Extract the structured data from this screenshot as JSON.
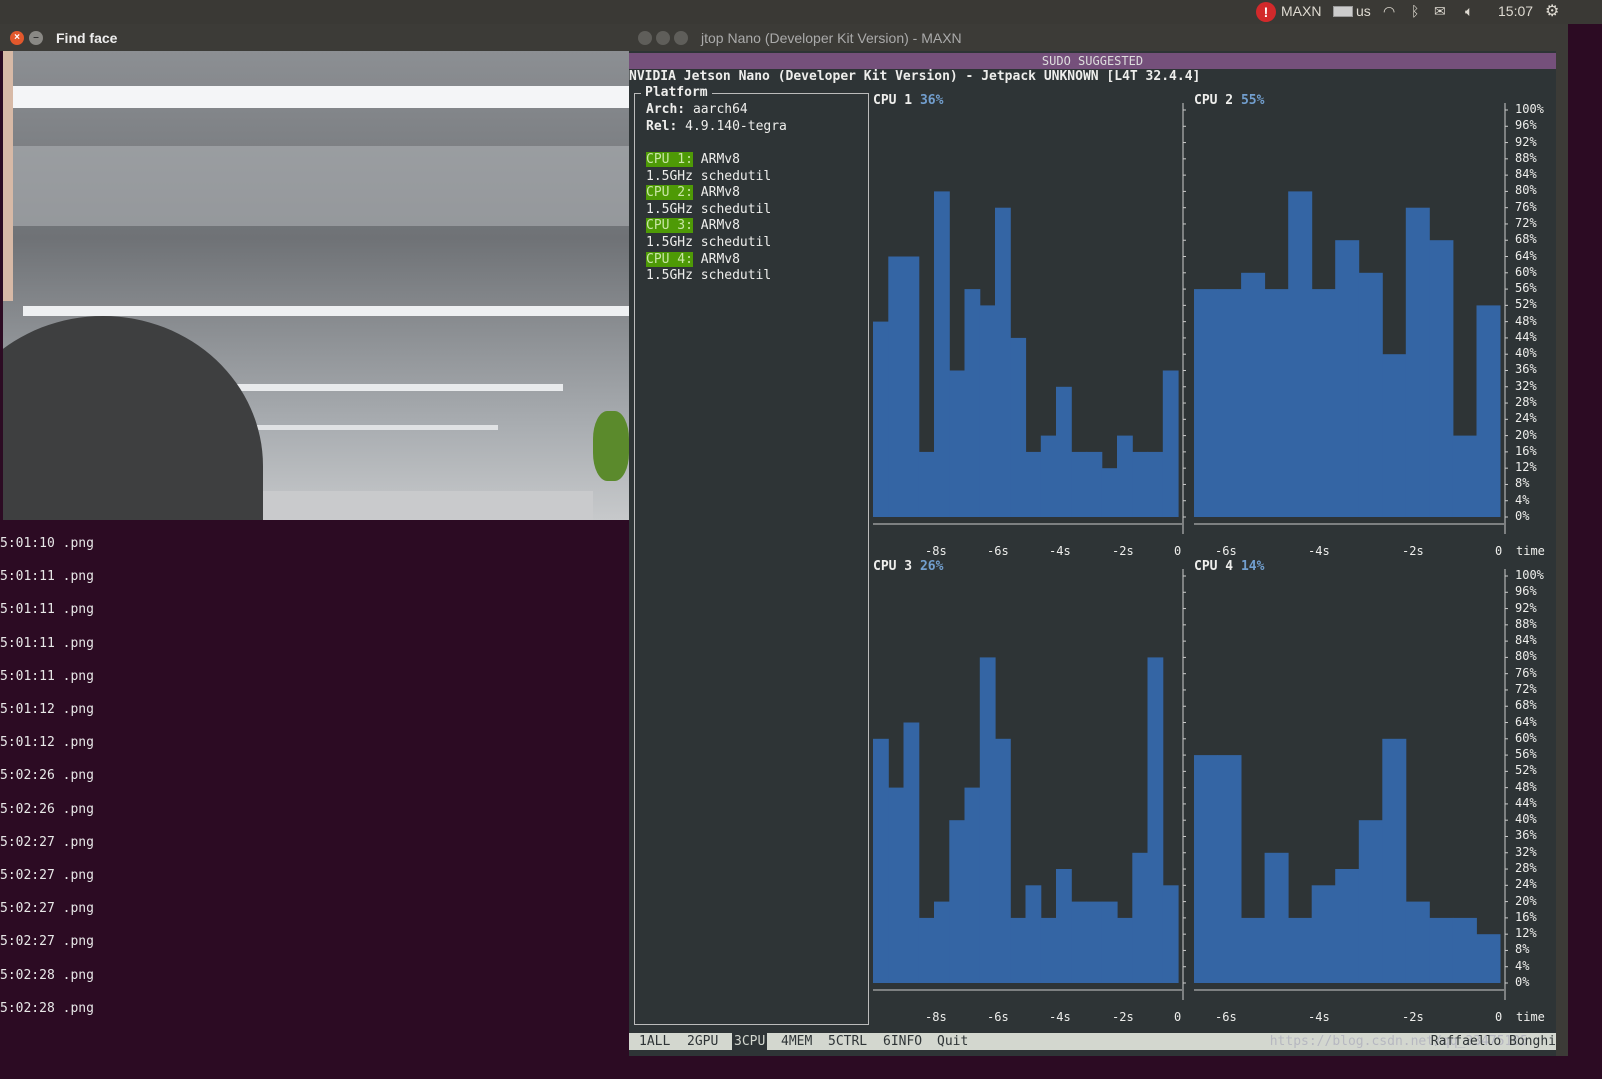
{
  "topbar": {
    "power_mode": "MAXN",
    "keyboard": "us",
    "time": "15:07",
    "icons": [
      "alert-icon",
      "keyboard-icon",
      "wifi-icon",
      "bluetooth-icon",
      "mail-icon",
      "volume-icon",
      "power-gear-icon"
    ]
  },
  "findface": {
    "title": "Find face"
  },
  "terminal": {
    "lines": [
      "5:01:10 .png",
      "5:01:11 .png",
      "5:01:11 .png",
      "5:01:11 .png",
      "5:01:11 .png",
      "5:01:12 .png",
      "5:01:12 .png",
      "5:02:26 .png",
      "5:02:26 .png",
      "5:02:27 .png",
      "5:02:27 .png",
      "5:02:27 .png",
      "5:02:27 .png",
      "5:02:28 .png",
      "5:02:28 .png"
    ]
  },
  "jtop": {
    "title": "jtop Nano (Developer Kit Version) - MAXN",
    "sudo": "SUDO SUGGESTED",
    "header": "NVIDIA Jetson Nano (Developer Kit Version) - Jetpack UNKNOWN [L4T 32.4.4]",
    "platform": {
      "title": "Platform",
      "arch_label": "Arch:",
      "arch": "aarch64",
      "rel_label": "Rel:",
      "rel": "4.9.140-tegra",
      "cpus": [
        {
          "label": "CPU 1:",
          "arch": "ARMv8",
          "freq": "1.5GHz schedutil"
        },
        {
          "label": "CPU 2:",
          "arch": "ARMv8",
          "freq": "1.5GHz schedutil"
        },
        {
          "label": "CPU 3:",
          "arch": "ARMv8",
          "freq": "1.5GHz schedutil"
        },
        {
          "label": "CPU 4:",
          "arch": "ARMv8",
          "freq": "1.5GHz schedutil"
        }
      ]
    },
    "bottom": {
      "tabs": [
        "1ALL",
        "2GPU",
        "3CPU",
        "4MEM",
        "5CTRL",
        "6INFO",
        "Quit"
      ],
      "selected": "3CPU",
      "author": "Raffaello Bonghi",
      "watermark": "https://blog.csdn.net/qq_33475105"
    }
  },
  "chart_data": [
    {
      "type": "bar",
      "title": "CPU 1",
      "value_label": "36%",
      "x_ticks": [
        "-8s",
        "-6s",
        "-4s",
        "-2s",
        "0"
      ],
      "ylim": [
        0,
        100
      ],
      "values": [
        48,
        64,
        64,
        16,
        80,
        36,
        56,
        52,
        76,
        44,
        16,
        20,
        32,
        16,
        16,
        12,
        20,
        16,
        16,
        36
      ],
      "color": "#3465a4"
    },
    {
      "type": "bar",
      "title": "CPU 2",
      "value_label": "55%",
      "x_ticks": [
        "-6s",
        "-4s",
        "-2s",
        "0"
      ],
      "xlabel": "time",
      "ylim": [
        0,
        100
      ],
      "y_ticks": [
        "100%",
        "96%",
        "92%",
        "88%",
        "84%",
        "80%",
        "76%",
        "72%",
        "68%",
        "64%",
        "60%",
        "56%",
        "52%",
        "48%",
        "44%",
        "40%",
        "36%",
        "32%",
        "28%",
        "24%",
        "20%",
        "16%",
        "12%",
        "8%",
        "4%",
        "0%"
      ],
      "values": [
        56,
        56,
        60,
        56,
        80,
        56,
        68,
        60,
        40,
        76,
        68,
        20,
        52
      ],
      "color": "#3465a4"
    },
    {
      "type": "bar",
      "title": "CPU 3",
      "value_label": "26%",
      "x_ticks": [
        "-8s",
        "-6s",
        "-4s",
        "-2s",
        "0"
      ],
      "ylim": [
        0,
        100
      ],
      "values": [
        60,
        48,
        64,
        16,
        20,
        40,
        48,
        80,
        60,
        16,
        24,
        16,
        28,
        20,
        20,
        20,
        16,
        32,
        80,
        24
      ],
      "color": "#3465a4"
    },
    {
      "type": "bar",
      "title": "CPU 4",
      "value_label": "14%",
      "x_ticks": [
        "-6s",
        "-4s",
        "-2s",
        "0"
      ],
      "xlabel": "time",
      "ylim": [
        0,
        100
      ],
      "y_ticks": [
        "100%",
        "96%",
        "92%",
        "88%",
        "84%",
        "80%",
        "76%",
        "72%",
        "68%",
        "64%",
        "60%",
        "56%",
        "52%",
        "48%",
        "44%",
        "40%",
        "36%",
        "32%",
        "28%",
        "24%",
        "20%",
        "16%",
        "12%",
        "8%",
        "4%",
        "0%"
      ],
      "values": [
        56,
        56,
        16,
        32,
        16,
        24,
        28,
        40,
        60,
        20,
        16,
        16,
        12
      ],
      "color": "#3465a4"
    }
  ]
}
